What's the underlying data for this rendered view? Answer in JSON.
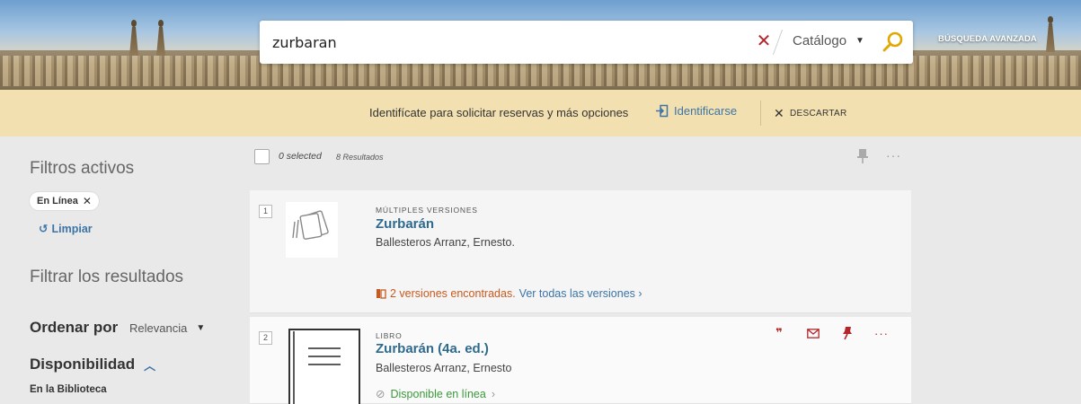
{
  "header": {
    "search_query": "zurbaran",
    "scope_label": "Catálogo",
    "advanced_search_label": "BÚSQUEDA AVANZADA"
  },
  "login_bar": {
    "message": "Identifícate para solicitar reservas y más opciones",
    "login_label": "Identificarse",
    "dismiss_label": "DESCARTAR"
  },
  "facets": {
    "active_filters_title": "Filtros activos",
    "active_chip": "En Línea",
    "clear_label": "Limpiar",
    "filter_title": "Filtrar los resultados",
    "sort_label": "Ordenar por",
    "sort_value": "Relevancia",
    "availability_label": "Disponibilidad",
    "availability_items": [
      "En la Biblioteca"
    ]
  },
  "results": {
    "selected_label": "0 selected",
    "count_label": "8 Resultados",
    "items": [
      {
        "number": "1",
        "type": "MÚLTIPLES VERSIONES",
        "title": "Zurbarán",
        "author": "Ballesteros Arranz, Ernesto.",
        "versions_found": "2 versiones encontradas.",
        "see_all": "Ver todas las versiones"
      },
      {
        "number": "2",
        "type": "LIBRO",
        "title": "Zurbarán (4a. ed.)",
        "author": "Ballesteros Arranz, Ernesto",
        "availability": "Disponible en línea"
      }
    ]
  },
  "colors": {
    "link_blue": "#3c74a6",
    "title_blue": "#2e6a8e",
    "accent_red": "#b3262a",
    "version_orange": "#c85a1e",
    "available_green": "#3a9a3a",
    "login_bar_bg": "#f2e0b0",
    "search_icon": "#e0a800"
  }
}
